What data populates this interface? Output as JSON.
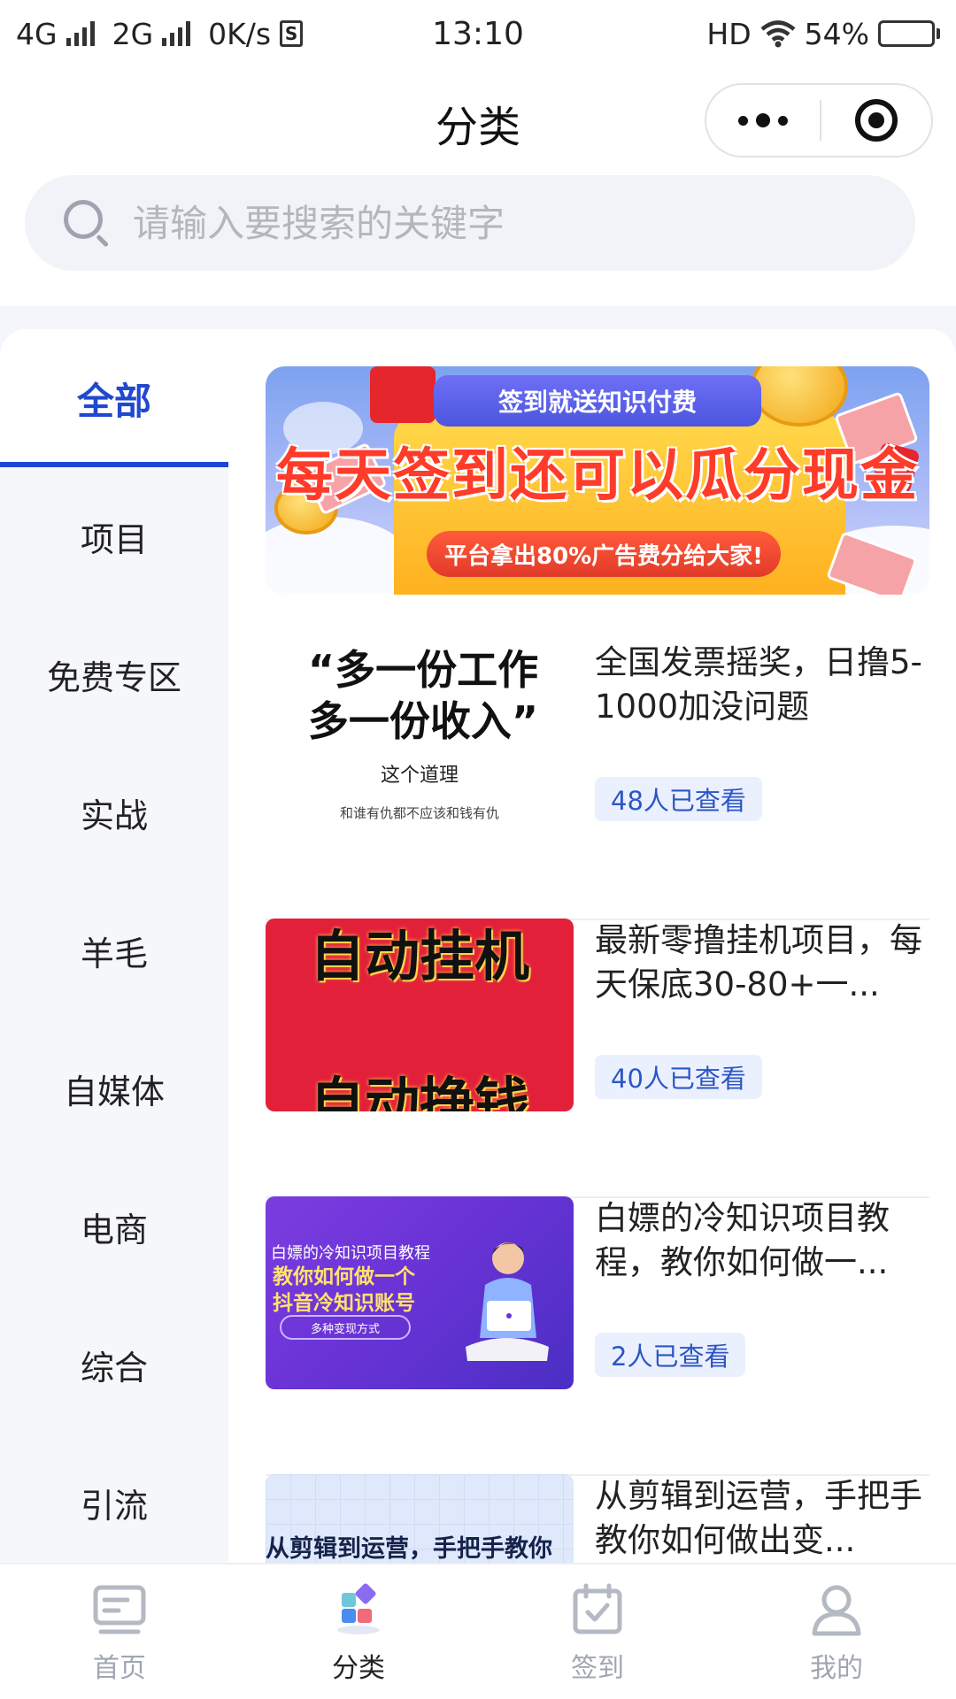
{
  "status_bar": {
    "network_left": "4G",
    "network_right": "2G",
    "speed": "0K/s",
    "time": "13:10",
    "hd": "HD",
    "battery": "54%",
    "battery_level": 0.54
  },
  "nav": {
    "title": "分类"
  },
  "search": {
    "placeholder": "请输入要搜索的关键字"
  },
  "sidebar": {
    "items": [
      {
        "label": "全部",
        "active": true
      },
      {
        "label": "项目"
      },
      {
        "label": "免费专区"
      },
      {
        "label": "实战"
      },
      {
        "label": "羊毛"
      },
      {
        "label": "自媒体"
      },
      {
        "label": "电商"
      },
      {
        "label": "综合"
      },
      {
        "label": "引流"
      }
    ]
  },
  "banner": {
    "tab_text": "签到就送知识付费",
    "headline": "每天签到还可以瓜分现金",
    "subline": "平台拿出80%广告费分给大家!"
  },
  "articles": [
    {
      "title": "全国发票摇奖，日撸5-1000加没问题",
      "views": "48人已查看",
      "thumb": {
        "line1": "“多一份工作",
        "line2": "多一份收入”",
        "line3": "这个道理",
        "line4": "和谁有仇都不应该和钱有仇"
      }
    },
    {
      "title": "最新零撸挂机项目，每天保底30-80+一...",
      "views": "40人已查看",
      "thumb": {
        "line1": "自动挂机",
        "line2": "自动挣钱"
      }
    },
    {
      "title": "白嫖的冷知识项目教程，教你如何做一...",
      "views": "2人已查看",
      "thumb": {
        "line1": "白嫖的冷知识项目教程",
        "line2": "教你如何做一个",
        "line3": "抖音冷知识账号",
        "line4": "多种变现方式"
      }
    },
    {
      "title": "从剪辑到运营，手把手教你如何做出变...",
      "views": "",
      "thumb": {
        "line1": "从剪辑到运营，手把手教你"
      }
    }
  ],
  "tabbar": {
    "items": [
      {
        "label": "首页",
        "icon": "home-screen-icon"
      },
      {
        "label": "分类",
        "icon": "category-icon",
        "active": true
      },
      {
        "label": "签到",
        "icon": "calendar-check-icon"
      },
      {
        "label": "我的",
        "icon": "user-icon"
      }
    ]
  },
  "colors": {
    "accent": "#2046d6",
    "views_bg": "#eaf0fd",
    "views_text": "#2c55c6"
  }
}
